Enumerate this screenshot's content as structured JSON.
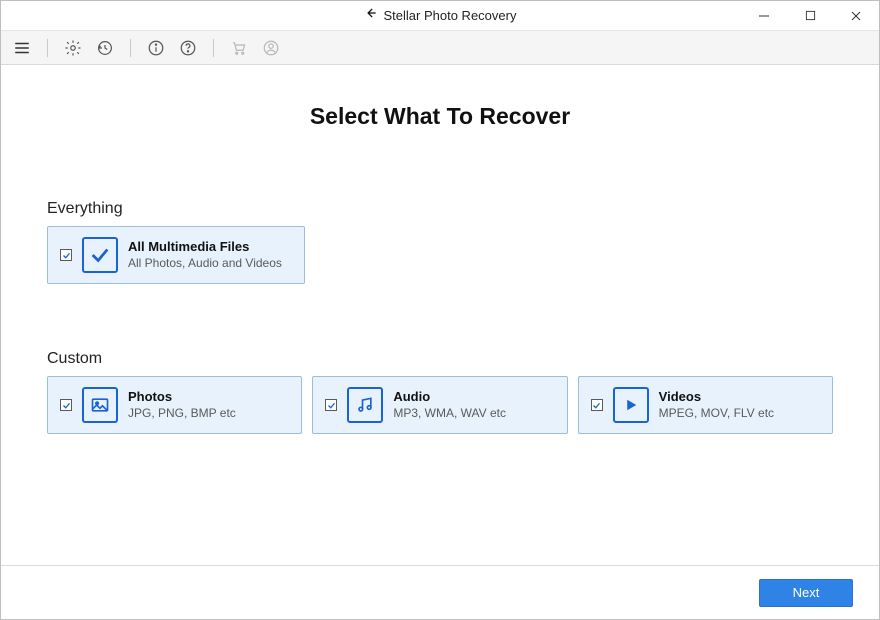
{
  "titlebar": {
    "app_title": "Stellar Photo Recovery"
  },
  "main": {
    "heading": "Select What To Recover",
    "section_everything": "Everything",
    "section_custom": "Custom",
    "everything_card": {
      "title": "All Multimedia Files",
      "sub": "All Photos, Audio and Videos",
      "checked": true,
      "icon": "checkmark-icon"
    },
    "custom_cards": [
      {
        "title": "Photos",
        "sub": "JPG, PNG, BMP etc",
        "checked": true,
        "icon": "image-icon"
      },
      {
        "title": "Audio",
        "sub": "MP3, WMA, WAV etc",
        "checked": true,
        "icon": "music-icon"
      },
      {
        "title": "Videos",
        "sub": "MPEG, MOV, FLV etc",
        "checked": true,
        "icon": "play-icon"
      }
    ]
  },
  "footer": {
    "next_label": "Next"
  },
  "colors": {
    "accent": "#2f82e6",
    "card_bg": "#e8f2fc",
    "card_border": "#9bbde0",
    "icon_blue": "#1a63d4"
  }
}
